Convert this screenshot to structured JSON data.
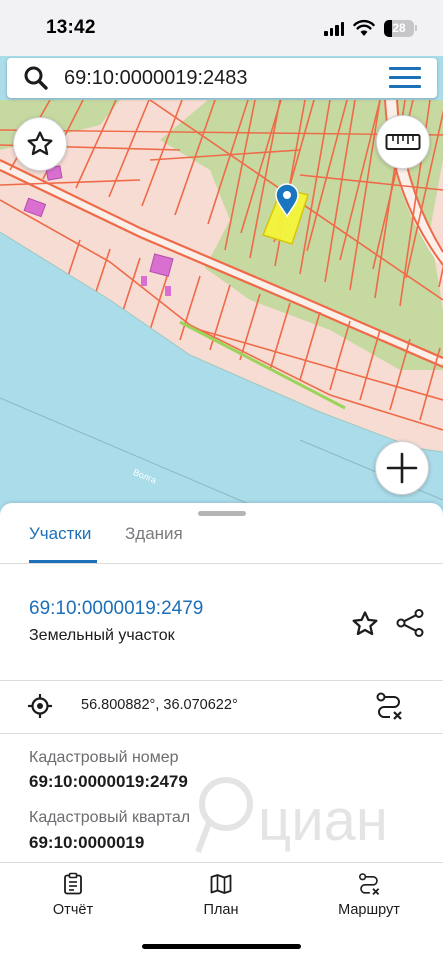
{
  "status_bar": {
    "time": "13:42",
    "battery": "28",
    "battery_level": 0.28
  },
  "search": {
    "value": "69:10:0000019:2483",
    "icon": "search-icon"
  },
  "map": {
    "colors": {
      "water": "#aadcea",
      "land": "#f7dcd3",
      "forest": "#c6d9a0",
      "parcel_line": "#ef6a48",
      "selected_parcel": "#f5f53a",
      "marker": "#1b76c0",
      "building": "#d96fd1"
    },
    "river_label": "Волга",
    "controls": {
      "favorite_icon": "star-icon",
      "ruler_icon": "ruler-icon",
      "zoom_in_icon": "plus-icon"
    }
  },
  "sheet": {
    "tabs": [
      {
        "label": "Участки",
        "active": true
      },
      {
        "label": "Здания",
        "active": false
      }
    ],
    "parcel": {
      "number": "69:10:0000019:2479",
      "type": "Земельный участок"
    },
    "coordinates": "56.800882°, 36.070622°",
    "fields": [
      {
        "label": "Кадастровый номер",
        "value": "69:10:0000019:2479"
      },
      {
        "label": "Кадастровый квартал",
        "value": "69:10:0000019"
      }
    ],
    "watermark_text": "циан"
  },
  "bottom_nav": [
    {
      "label": "Отчёт",
      "icon": "report-icon"
    },
    {
      "label": "План",
      "icon": "map-icon"
    },
    {
      "label": "Маршрут",
      "icon": "route-icon"
    }
  ]
}
